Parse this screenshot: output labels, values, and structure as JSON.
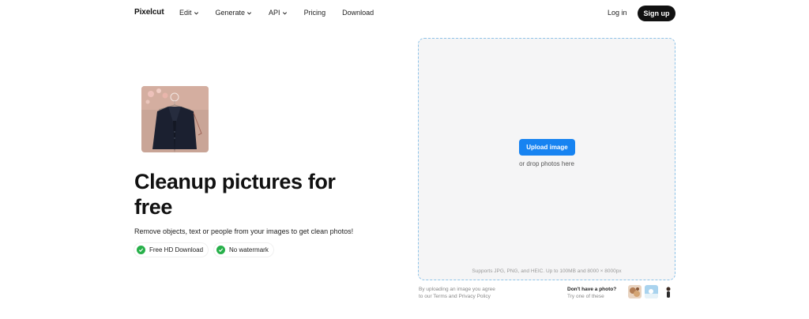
{
  "header": {
    "logo": "Pixelcut",
    "menu": [
      {
        "label": "Edit",
        "has_dropdown": true
      },
      {
        "label": "Generate",
        "has_dropdown": true
      },
      {
        "label": "API",
        "has_dropdown": true
      },
      {
        "label": "Pricing",
        "has_dropdown": false
      },
      {
        "label": "Download",
        "has_dropdown": false
      }
    ],
    "login": "Log in",
    "signup": "Sign up"
  },
  "hero": {
    "headline": "Cleanup pictures for free",
    "subtitle": "Remove objects, text or people from your images to get clean photos!",
    "badges": [
      "Free HD Download",
      "No watermark"
    ]
  },
  "upload": {
    "button": "Upload image",
    "drop_text": "or drop photos here",
    "supports": "Supports JPG, PNG, and HEIC. Up to 100MB and 8000 × 8000px"
  },
  "footer": {
    "terms_line1": "By uploading an image you agree",
    "terms_line2": "to our Terms and Privacy Policy",
    "nophoto_title": "Don't have a photo?",
    "nophoto_sub": "Try one of these"
  },
  "colors": {
    "accent": "#1783f1",
    "check": "#27b04a",
    "dark": "#111111"
  }
}
